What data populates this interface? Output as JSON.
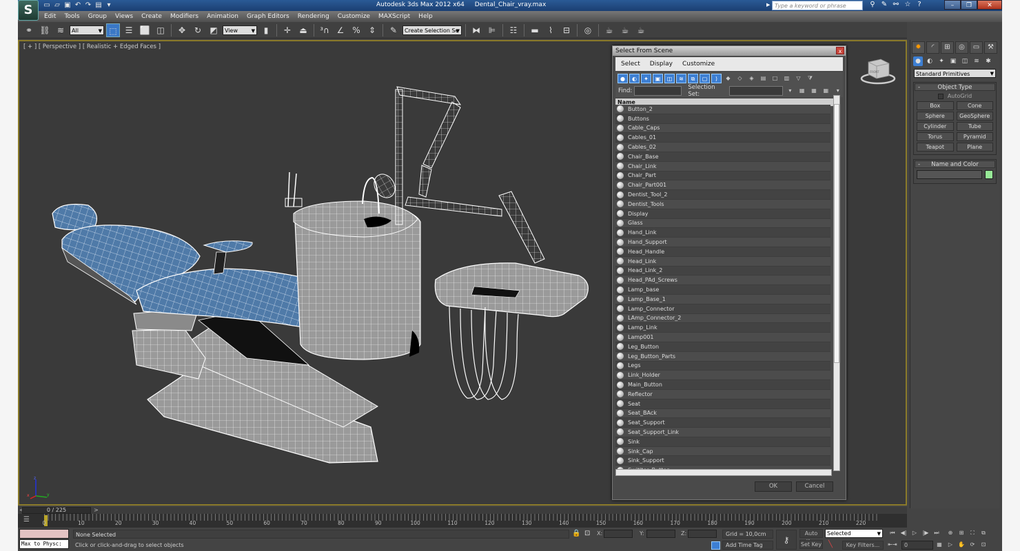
{
  "titlebar": {
    "app_name": "Autodesk 3ds Max  2012 x64",
    "file_name": "Dental_Chair_vray.max",
    "search_placeholder": "Type a keyword or phrase",
    "qat_icons": [
      "new-icon",
      "open-icon",
      "save-icon",
      "undo-icon",
      "redo-icon",
      "project-icon"
    ],
    "info_icons": [
      "binoculars-icon",
      "wrench-icon",
      "satellite-icon",
      "star-icon",
      "help-icon"
    ],
    "window_controls": [
      "minimize",
      "restore",
      "close"
    ]
  },
  "menu": {
    "items": [
      "Edit",
      "Tools",
      "Group",
      "Views",
      "Create",
      "Modifiers",
      "Animation",
      "Graph Editors",
      "Rendering",
      "Customize",
      "MAXScript",
      "Help"
    ]
  },
  "toolbar": {
    "selection_filter": "All",
    "reference_coord": "View",
    "named_selection": "Create Selection Se"
  },
  "viewport": {
    "label": "[ + ] [ Perspective ] [ Realistic + Edged Faces ]",
    "axis": {
      "x": "x",
      "y": "y",
      "z": "z"
    },
    "viewcube_label": "FRONT"
  },
  "dialog": {
    "title": "Select From Scene",
    "close_label": "x",
    "menu": [
      "Select",
      "Display",
      "Customize"
    ],
    "find_label": "Find:",
    "find_value": "",
    "selection_set_label": "Selection Set:",
    "column_header": "Name",
    "objects": [
      "Button_2",
      "Buttons",
      "Cable_Caps",
      "Cables_01",
      "Cables_02",
      "Chair_Base",
      "Chair_Link",
      "Chair_Part",
      "Chair_Part001",
      "Dentist_Tool_2",
      "Dentist_Tools",
      "Display",
      "Glass",
      "Hand_Link",
      "Hand_Support",
      "Head_Handle",
      "Head_Link",
      "Head_Link_2",
      "Head_PAd_Screws",
      "Lamp_base",
      "Lamp_Base_1",
      "Lamp_Connector",
      "LAmp_Connector_2",
      "Lamp_Link",
      "Lamp001",
      "Leg_Button",
      "Leg_Button_Parts",
      "Legs",
      "Link_Holder",
      "Main_Button",
      "Reflector",
      "Seat",
      "Seat_BAck",
      "Seat_Support",
      "Seat_Support_Link",
      "Sink",
      "Sink_Cap",
      "Sink_Support",
      "Switlter_Button"
    ],
    "ok_label": "OK",
    "cancel_label": "Cancel"
  },
  "command_panel": {
    "tabs": [
      "create",
      "modify",
      "hierarchy",
      "motion",
      "display",
      "utilities"
    ],
    "category": "Standard Primitives",
    "object_type_title": "Object Type",
    "autogrid_label": "AutoGrid",
    "autogrid_checked": false,
    "primitives": [
      "Box",
      "Cone",
      "Sphere",
      "GeoSphere",
      "Cylinder",
      "Tube",
      "Torus",
      "Pyramid",
      "Teapot",
      "Plane"
    ],
    "name_color_title": "Name and Color",
    "name_value": "",
    "object_color": "#96e896"
  },
  "timeline": {
    "frame_display": "0 / 225",
    "prev_label": "<",
    "next_label": ">",
    "current_frame": 0,
    "ticks": [
      "0",
      "10",
      "20",
      "30",
      "40",
      "50",
      "60",
      "70",
      "80",
      "90",
      "100",
      "110",
      "120",
      "130",
      "140",
      "150",
      "160",
      "170",
      "180",
      "190",
      "200",
      "210",
      "220"
    ]
  },
  "status": {
    "maxscript_listener": "Max to Physc:",
    "selection_status": "None Selected",
    "prompt": "Click or click-and-drag to select objects",
    "x_label": "X:",
    "y_label": "Y:",
    "z_label": "Z:",
    "x_value": "",
    "y_value": "",
    "z_value": "",
    "grid": "Grid = 10,0cm",
    "add_time_tag": "Add Time Tag",
    "auto_key": "Auto Key",
    "set_key": "Set Key",
    "key_mode": "Selected",
    "key_filters": "Key Filters...",
    "frame_value": "0"
  }
}
